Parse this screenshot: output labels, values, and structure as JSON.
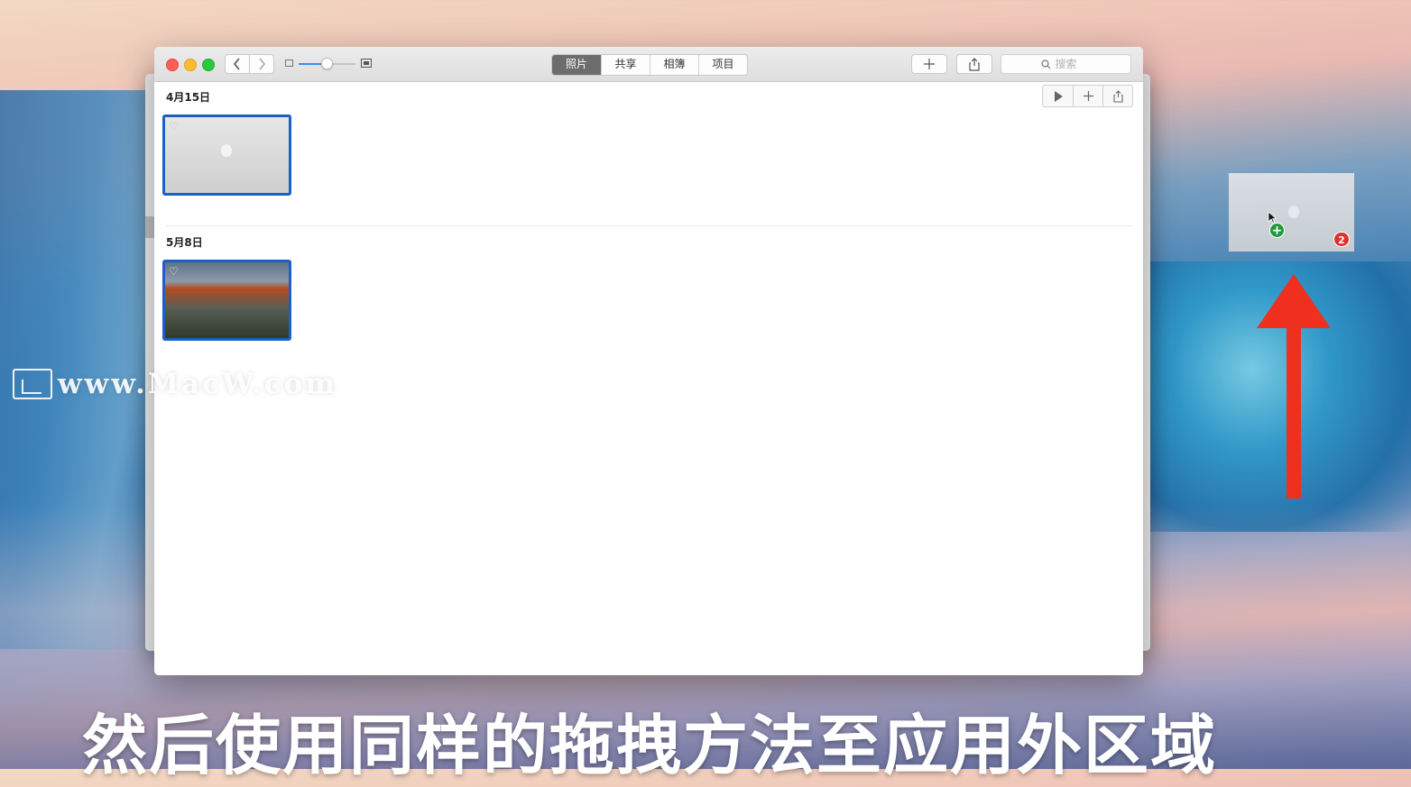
{
  "toolbar": {
    "tabs": [
      {
        "label": "照片",
        "active": true
      },
      {
        "label": "共享",
        "active": false
      },
      {
        "label": "相簿",
        "active": false
      },
      {
        "label": "项目",
        "active": false
      }
    ],
    "search_placeholder": "搜索"
  },
  "library": {
    "moments": [
      {
        "date": "4月15日"
      },
      {
        "date": "5月8日"
      }
    ]
  },
  "drag": {
    "item_count": "2",
    "copy_badge": "+"
  },
  "watermark": {
    "text": "www.MacW.com"
  },
  "caption": {
    "text": "然后使用同样的拖拽方法至应用外区域"
  },
  "colors": {
    "accent_blue": "#1f5fc5",
    "arrow_red": "#f0301e",
    "badge_green": "#1f9a3a",
    "badge_red": "#e0312f"
  }
}
